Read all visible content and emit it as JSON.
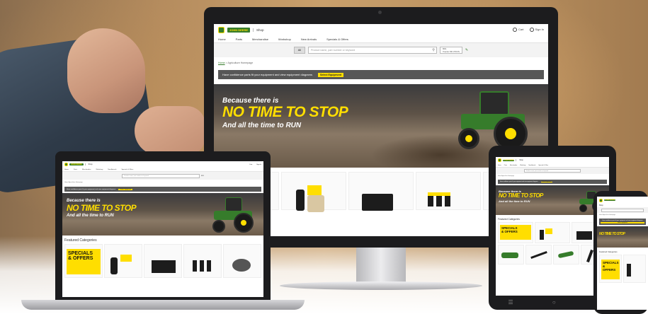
{
  "brand": {
    "logo_text": "JOHN DEERE",
    "shop_label": "Shop",
    "green": "#367c2b",
    "yellow": "#ffde00"
  },
  "header": {
    "cart_label": "Cart",
    "signin_label": "Sign In"
  },
  "nav": {
    "items": [
      "Home",
      "Parts",
      "Merchandise",
      "Workshop",
      "New Arrivals",
      "Specials & Offers"
    ]
  },
  "search": {
    "category": "All",
    "placeholder": "Product name, part number or keyword",
    "equipment_line1": "8R1",
    "equipment_line2": "Tractor 8R 370VS"
  },
  "breadcrumb": {
    "home": "Home",
    "separator": ">",
    "current": "Agriculture Homepage"
  },
  "promo": {
    "text": "Have confidence parts fit your equipment and view equipment diagrams",
    "button": "Select Equipment"
  },
  "hero": {
    "line1": "Because there is",
    "line2": "NO TIME TO STOP",
    "line3": "And all the time to RUN"
  },
  "featured": {
    "heading": "Featured Categories",
    "specials_text_1": "SPECIALS",
    "specials_text_2": "& OFFERS"
  },
  "icons": {
    "cart": "cart-icon",
    "user": "user-icon",
    "search": "search-icon",
    "edit": "pencil-icon"
  }
}
